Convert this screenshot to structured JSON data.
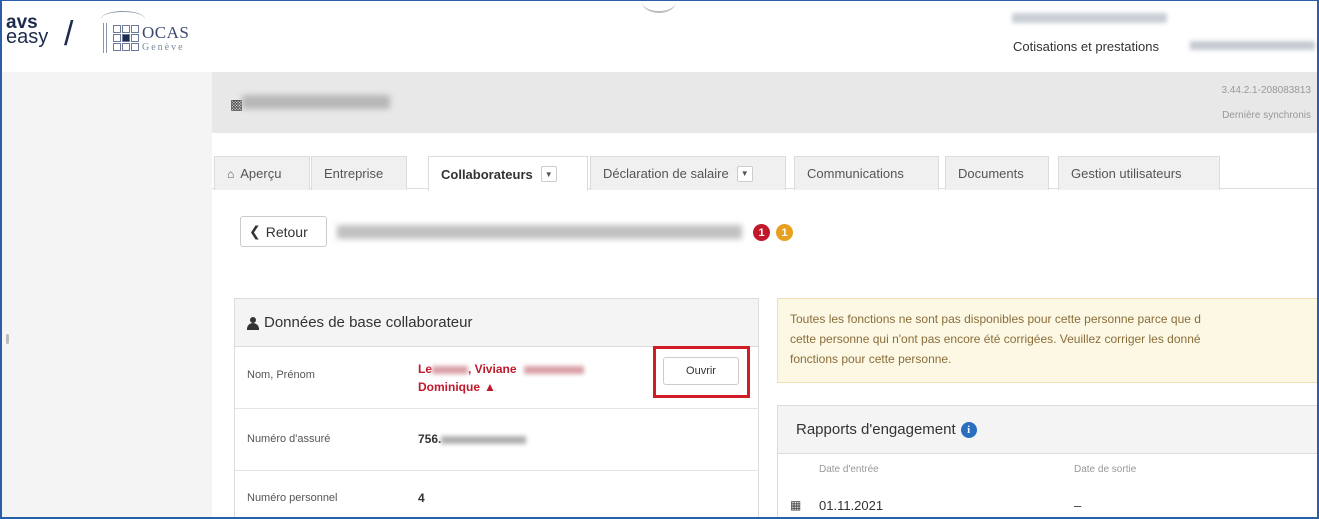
{
  "header": {
    "logo_avs": "avs",
    "logo_easy": "easy",
    "logo_ocas": "OCAS",
    "logo_geneve": "Genève",
    "cotisations_label": "Cotisations et prestations"
  },
  "page_header": {
    "version": "3.44.2.1-208083813",
    "sync_label": "Dernière synchronis"
  },
  "tabs": [
    {
      "label": "Aperçu",
      "icon": "home-icon"
    },
    {
      "label": "Entreprise"
    },
    {
      "label": "Collaborateurs",
      "active": true,
      "dropdown": true
    },
    {
      "label": "Déclaration de salaire",
      "dropdown": true
    },
    {
      "label": "Communications"
    },
    {
      "label": "Documents"
    },
    {
      "label": "Gestion utilisateurs"
    }
  ],
  "retour_label": "Retour",
  "badges": {
    "error_count": "1",
    "warning_count": "1"
  },
  "base_panel": {
    "title": "Données de base collaborateur",
    "rows": [
      {
        "label": "Nom, Prénom",
        "value_part1": "Le",
        "value_part2": ", Viviane",
        "value_line2": "Dominique"
      },
      {
        "label": "Numéro d'assuré",
        "value": "756."
      },
      {
        "label": "Numéro personnel",
        "value": "4"
      }
    ],
    "open_button": "Ouvrir"
  },
  "alert": {
    "line1": "Toutes les fonctions ne sont pas disponibles pour cette personne parce que d",
    "line2": "cette personne qui n'ont pas encore été corrigées. Veuillez corriger les donné",
    "line3": "fonctions pour cette personne."
  },
  "engagement": {
    "title": "Rapports d'engagement",
    "col_entry": "Date d'entrée",
    "col_exit": "Date de sortie",
    "rows": [
      {
        "entry": "01.11.2021",
        "exit": "–"
      }
    ]
  },
  "colors": {
    "accent": "#2a5ea8",
    "error": "#c0192b",
    "warning": "#e8a020",
    "highlight": "#d01c24"
  }
}
